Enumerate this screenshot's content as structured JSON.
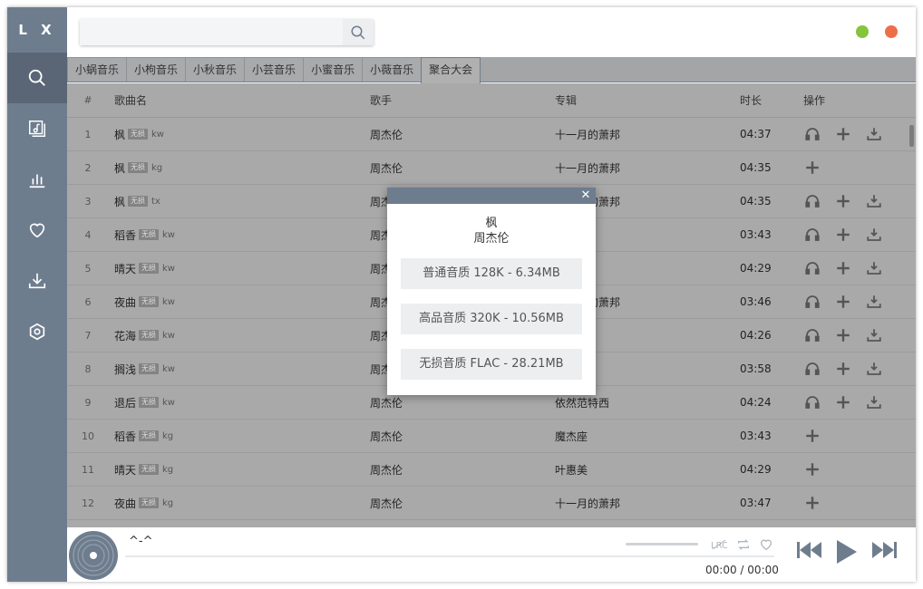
{
  "app": {
    "logo": "L X"
  },
  "search": {
    "value": "",
    "placeholder": ""
  },
  "tabs": [
    {
      "label": "小蜗音乐"
    },
    {
      "label": "小枸音乐"
    },
    {
      "label": "小秋音乐"
    },
    {
      "label": "小芸音乐"
    },
    {
      "label": "小蜜音乐"
    },
    {
      "label": "小薇音乐"
    },
    {
      "label": "聚合大会"
    }
  ],
  "table": {
    "headers": {
      "idx": "#",
      "name": "歌曲名",
      "artist": "歌手",
      "album": "专辑",
      "duration": "时长",
      "ops": "操作"
    },
    "rows": [
      {
        "idx": "1",
        "name": "枫",
        "badge": "无损",
        "src": "kw",
        "artist": "周杰伦",
        "album": "十一月的萧邦",
        "duration": "04:37"
      },
      {
        "idx": "2",
        "name": "枫",
        "badge": "无损",
        "src": "kg",
        "artist": "周杰伦",
        "album": "十一月的萧邦",
        "duration": "04:35"
      },
      {
        "idx": "3",
        "name": "枫",
        "badge": "无损",
        "src": "tx",
        "artist": "周杰伦",
        "album": "十一月的萧邦",
        "duration": "04:35"
      },
      {
        "idx": "4",
        "name": "稻香",
        "badge": "无损",
        "src": "kw",
        "artist": "周杰伦",
        "album": "",
        "duration": "03:43"
      },
      {
        "idx": "5",
        "name": "晴天",
        "badge": "无损",
        "src": "kw",
        "artist": "周杰伦",
        "album": "",
        "duration": "04:29"
      },
      {
        "idx": "6",
        "name": "夜曲",
        "badge": "无损",
        "src": "kw",
        "artist": "周杰伦",
        "album": "十一月的萧邦",
        "duration": "03:46"
      },
      {
        "idx": "7",
        "name": "花海",
        "badge": "无损",
        "src": "kw",
        "artist": "周杰伦",
        "album": "",
        "duration": "04:26"
      },
      {
        "idx": "8",
        "name": "搁浅",
        "badge": "无损",
        "src": "kw",
        "artist": "周杰伦",
        "album": "",
        "duration": "03:58"
      },
      {
        "idx": "9",
        "name": "退后",
        "badge": "无损",
        "src": "kw",
        "artist": "周杰伦",
        "album": "依然范特西",
        "duration": "04:24"
      },
      {
        "idx": "10",
        "name": "稻香",
        "badge": "无损",
        "src": "kg",
        "artist": "周杰伦",
        "album": "魔杰座",
        "duration": "03:43"
      },
      {
        "idx": "11",
        "name": "晴天",
        "badge": "无损",
        "src": "kg",
        "artist": "周杰伦",
        "album": "叶惠美",
        "duration": "04:29"
      },
      {
        "idx": "12",
        "name": "夜曲",
        "badge": "无损",
        "src": "kg",
        "artist": "周杰伦",
        "album": "十一月的萧邦",
        "duration": "03:47"
      }
    ]
  },
  "player": {
    "title": "^-^",
    "current_time": "00:00",
    "separator": "/",
    "total_time": "00:00"
  },
  "modal": {
    "title": "枫",
    "subtitle": "周杰伦",
    "close": "✕",
    "options": [
      {
        "label": "普通音质 128K - 6.34MB"
      },
      {
        "label": "高品音质 320K - 10.56MB"
      },
      {
        "label": "无损音质 FLAC - 28.21MB"
      }
    ]
  },
  "colors": {
    "sidebar": "#6e7d8e",
    "minimize": "#85c43b",
    "close": "#ed6f4a"
  }
}
